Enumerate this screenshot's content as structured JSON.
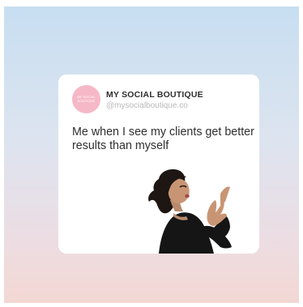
{
  "post": {
    "brand": {
      "avatar_text": "MY SOCIAL BOUTIQUE",
      "name": "MY SOCIAL BOUTIQUE",
      "handle": "@mysocialboutique.co"
    },
    "text": "Me when I see my clients get better results than myself",
    "sticker_icon": "blowing-kiss-woman-sticker"
  },
  "colors": {
    "background_top": "#c7def1",
    "background_bottom": "#f3d7d3",
    "avatar": "#f6b8c6",
    "card": "#ffffff",
    "text": "#2f2f2f",
    "handle": "#b9b9b9"
  }
}
